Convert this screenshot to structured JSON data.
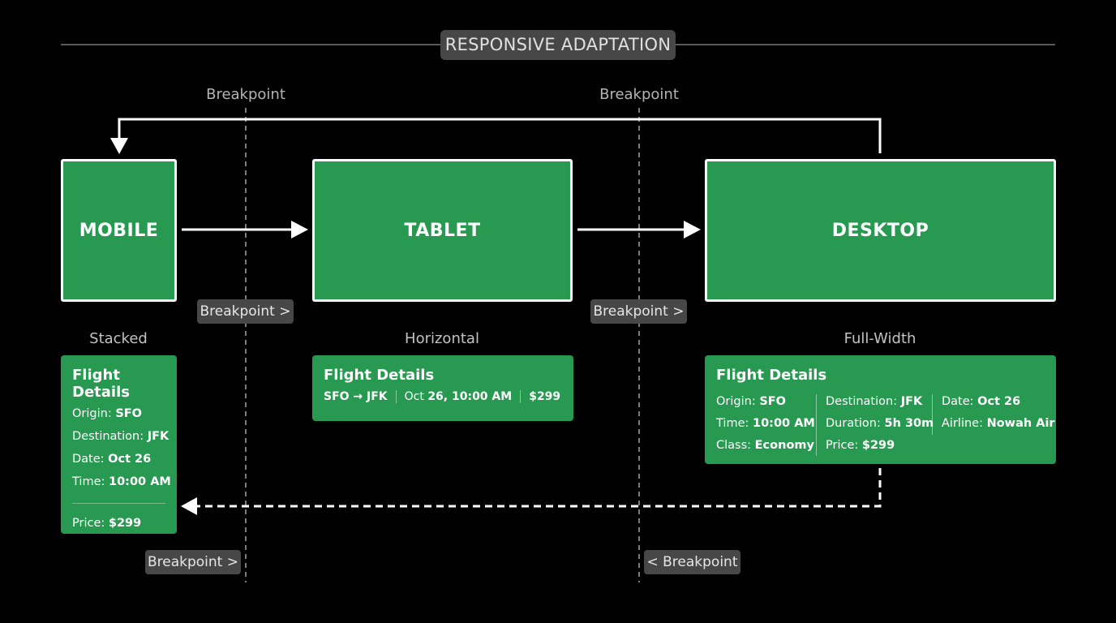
{
  "title": "RESPONSIVE ADAPTATION",
  "breakpoint_labels": {
    "top_left": "Breakpoint",
    "top_right": "Breakpoint",
    "mid_left": "Breakpoint >",
    "mid_right": "Breakpoint >",
    "bottom_left": "Breakpoint >",
    "bottom_right": "< Breakpoint"
  },
  "devices": {
    "mobile": "MOBILE",
    "tablet": "TABLET",
    "desktop": "DESKTOP"
  },
  "layouts": {
    "mobile": "Stacked",
    "tablet": "Horizontal",
    "desktop": "Full-Width"
  },
  "cards": {
    "mobile": {
      "title": "Flight Details",
      "rows": [
        {
          "label": "Origin: ",
          "value": "SFO"
        },
        {
          "label": "Destination: ",
          "value": "JFK"
        },
        {
          "label": "Date: ",
          "value": "Oct 26"
        },
        {
          "label": "Time: ",
          "value": "10:00 AM"
        }
      ],
      "price_label": "Price: ",
      "price_value": "$299"
    },
    "tablet": {
      "title": "Flight Details",
      "route": "SFO → JFK",
      "datetime_prefix": "Oct ",
      "datetime_value": "26, 10:00 AM",
      "price": "$299"
    },
    "desktop": {
      "title": "Flight Details",
      "col1": [
        {
          "label": "Origin: ",
          "value": "SFO"
        },
        {
          "label": "Time: ",
          "value": "10:00 AM"
        },
        {
          "label": "Class: ",
          "value": "Economy"
        }
      ],
      "col2": [
        {
          "label": "Destination: ",
          "value": "JFK"
        },
        {
          "label": "Duration: ",
          "value": "5h 30m"
        },
        {
          "label": "Price: ",
          "value": "$299"
        }
      ],
      "col3": [
        {
          "label": "Date: ",
          "value": "Oct 26"
        },
        {
          "label": "Airline: ",
          "value": "Nowah Air"
        }
      ]
    }
  },
  "colors": {
    "green": "#289950",
    "pill": "#474747",
    "background": "#000000"
  }
}
